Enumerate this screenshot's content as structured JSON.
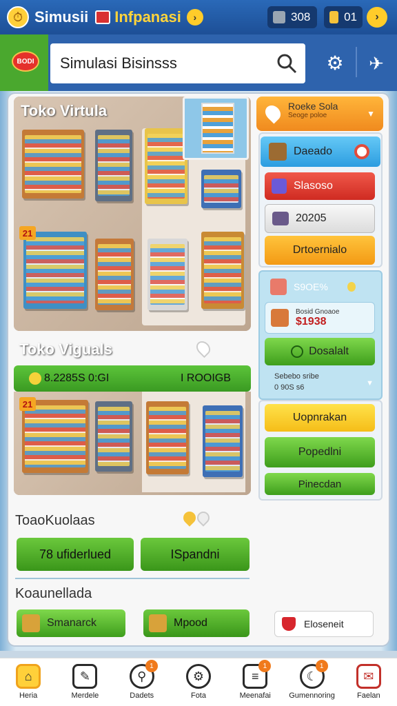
{
  "topbar": {
    "title": "Simusii",
    "brand": "Infpanasi",
    "help_icon": "help-icon",
    "stat1": {
      "icon": "pickaxe-icon",
      "value": "308"
    },
    "stat2": {
      "icon": "trophy-icon",
      "value": "01"
    },
    "next_icon": "arrow-right-icon"
  },
  "searchbar": {
    "badge_label": "BODI",
    "query": "Simulasi Bisinsss",
    "search_icon": "search-icon",
    "settings_icon": "gear-icon",
    "tools_icon": "tools-icon"
  },
  "store1": {
    "title": "Toko Virtula",
    "tag": "21"
  },
  "store2": {
    "title": "Toko Viguals",
    "tag": "21"
  },
  "rank_strip": {
    "left": "8.2285S 0:GI",
    "right": "I ROOIGB"
  },
  "right_panel": {
    "header_title": "Roeke Sola",
    "header_sub": "Seoge poloe",
    "btn1": "Daeado",
    "btn2": "Slasoso",
    "btn3": "20205",
    "btn4": "Drtoernialo",
    "info1_title": "S9OE%",
    "info2_title": "Bosid Gnoaoe",
    "info2_value": "$1938",
    "btn5": "Dosalalt",
    "mini1": "Sebebo sribe",
    "mini2": "0 90S s6",
    "btn6": "Uopnrakan",
    "btn7": "Popedlni",
    "btn8": "Pinecdan"
  },
  "section1": {
    "title": "ToaoKuolaas",
    "btn1": "78 ufiderlued",
    "btn2": "ISpandni"
  },
  "section2": {
    "title": "Koaunellada",
    "btn1": "Smanarck",
    "btn2": "Mpood",
    "btn3": "Eloseneit"
  },
  "nav": [
    {
      "label": "Heria",
      "icon": "home-icon",
      "badge": ""
    },
    {
      "label": "Merdele",
      "icon": "notes-icon",
      "badge": ""
    },
    {
      "label": "Dadets",
      "icon": "search-icon",
      "badge": "1"
    },
    {
      "label": "Fota",
      "icon": "gear-icon",
      "badge": ""
    },
    {
      "label": "Meenafai",
      "icon": "list-icon",
      "badge": "1"
    },
    {
      "label": "Gumennoring",
      "icon": "chat-icon",
      "badge": "1"
    },
    {
      "label": "Faelan",
      "icon": "mail-icon",
      "badge": ""
    }
  ],
  "colors": {
    "topbar": "#2a69b8",
    "accent_green": "#4aa82e",
    "accent_orange": "#f5a623",
    "badge_red": "#e5312b"
  }
}
